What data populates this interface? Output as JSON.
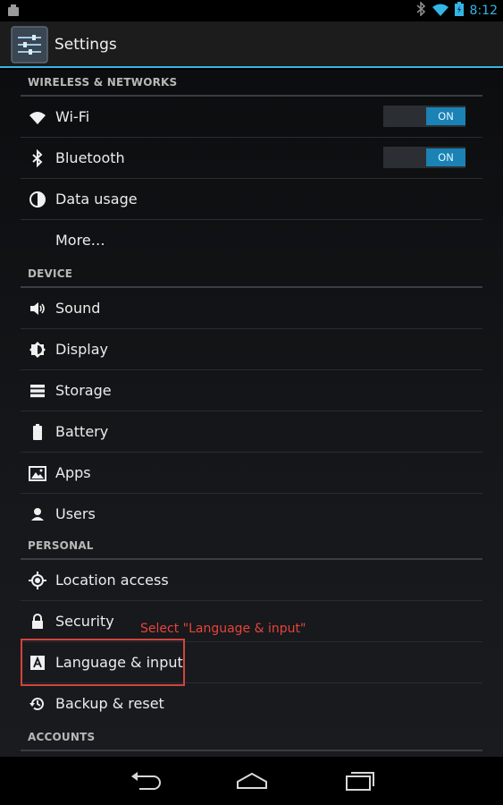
{
  "status_bar": {
    "time": "8:12",
    "icons": [
      "notification-icon",
      "bluetooth-icon",
      "wifi-icon",
      "battery-icon"
    ]
  },
  "action_bar": {
    "title": "Settings",
    "icon": "settings-sliders-icon"
  },
  "sections": {
    "wireless": {
      "header": "WIRELESS & NETWORKS",
      "items": [
        {
          "label": "Wi-Fi",
          "icon": "wifi-icon",
          "toggle": "ON"
        },
        {
          "label": "Bluetooth",
          "icon": "bluetooth-icon",
          "toggle": "ON"
        },
        {
          "label": "Data usage",
          "icon": "data-usage-icon"
        },
        {
          "label": "More…"
        }
      ]
    },
    "device": {
      "header": "DEVICE",
      "items": [
        {
          "label": "Sound",
          "icon": "sound-icon"
        },
        {
          "label": "Display",
          "icon": "display-icon"
        },
        {
          "label": "Storage",
          "icon": "storage-icon"
        },
        {
          "label": "Battery",
          "icon": "battery-icon"
        },
        {
          "label": "Apps",
          "icon": "apps-icon"
        },
        {
          "label": "Users",
          "icon": "users-icon"
        }
      ]
    },
    "personal": {
      "header": "PERSONAL",
      "items": [
        {
          "label": "Location access",
          "icon": "location-icon"
        },
        {
          "label": "Security",
          "icon": "lock-icon"
        },
        {
          "label": "Language & input",
          "icon": "language-icon"
        },
        {
          "label": "Backup & reset",
          "icon": "backup-icon"
        }
      ]
    },
    "accounts": {
      "header": "ACCOUNTS"
    }
  },
  "annotation": {
    "text": "Select \"Language & input\"",
    "color": "#e8433a"
  },
  "nav_bar": {
    "buttons": [
      "back-icon",
      "home-icon",
      "recent-apps-icon"
    ]
  },
  "colors": {
    "accent": "#33b5e5",
    "toggle_on": "#1a82b4"
  }
}
